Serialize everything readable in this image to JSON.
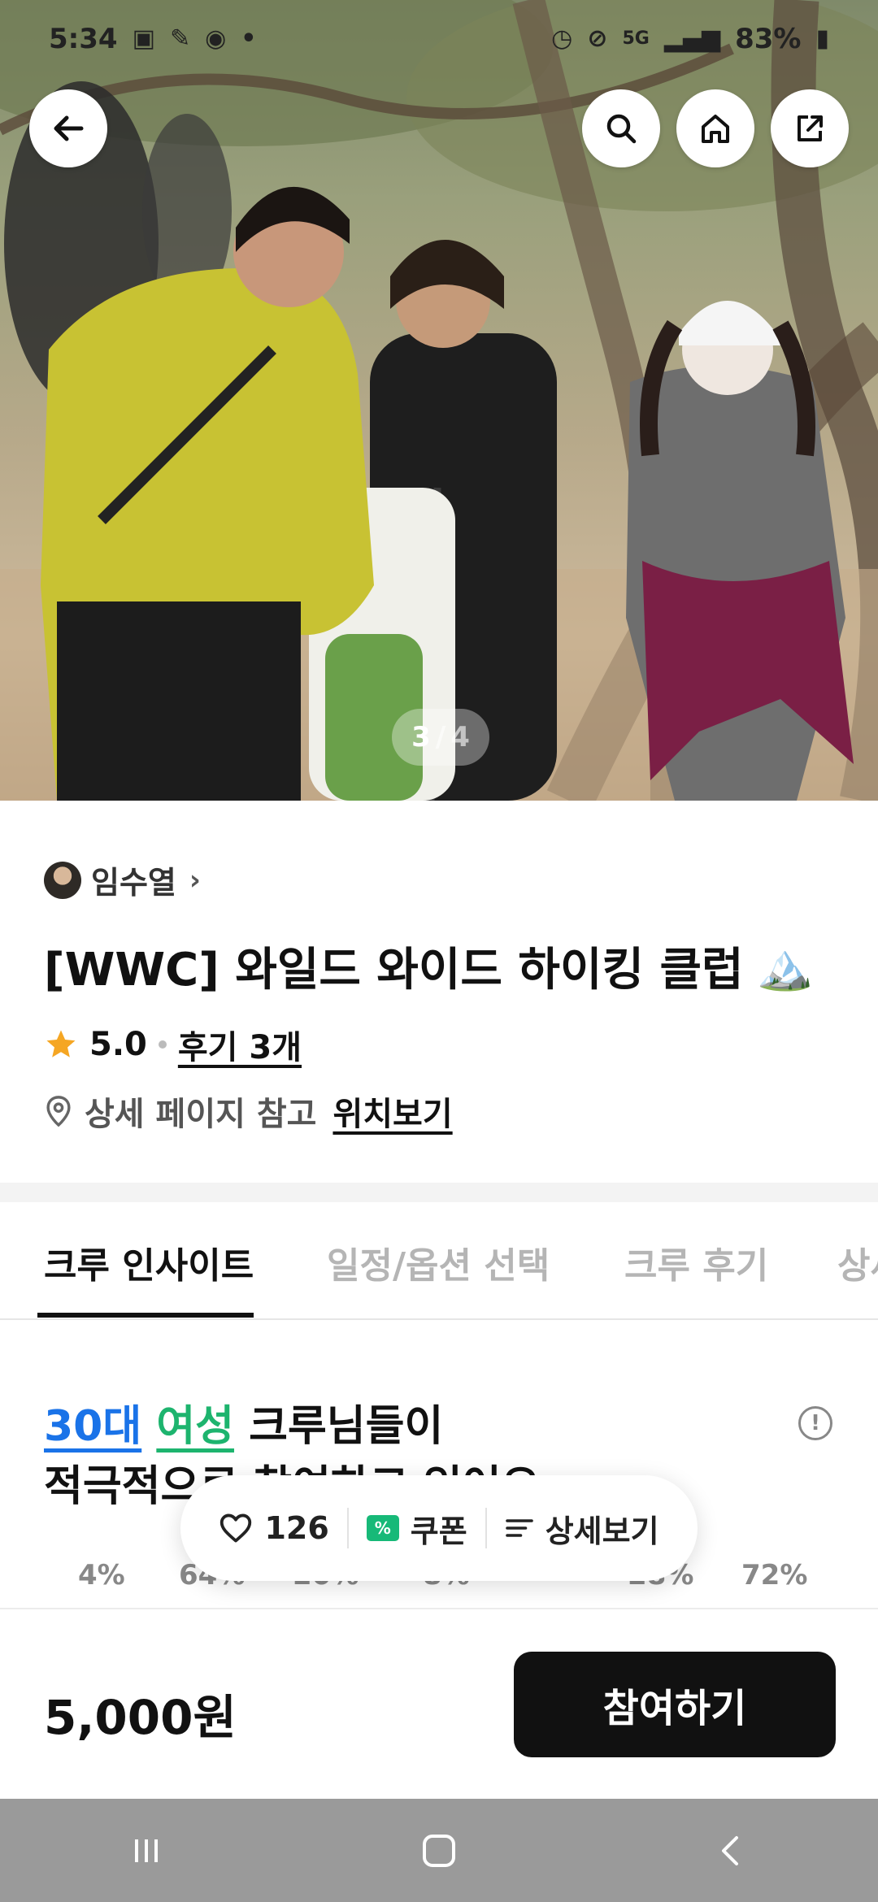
{
  "status_bar": {
    "time": "5:34",
    "battery": "83%",
    "network": "5G"
  },
  "hero": {
    "page_current": "3",
    "page_separator": "/",
    "page_total": "4"
  },
  "host": {
    "name": "임수열",
    "chevron": "›"
  },
  "crew": {
    "title": "[WWC] 와일드 와이드 하이킹 클럽",
    "title_emoji": "🏔️",
    "rating": "5.0",
    "reviews_label": "후기 3개",
    "location_text": "상세 페이지 참고",
    "location_link": "위치보기"
  },
  "tabs": [
    {
      "label": "크루 인사이트"
    },
    {
      "label": "일정/옵션 선택"
    },
    {
      "label": "크루 후기"
    },
    {
      "label": "상세"
    }
  ],
  "insight": {
    "age": "30대",
    "gender": "여성",
    "line1_rest": "크루님들이",
    "line2": "적극적으로 참여하고 있어요",
    "percentages": [
      "4%",
      "64%",
      "20%",
      "8%",
      "28%",
      "72%"
    ]
  },
  "floating_bar": {
    "likes": "126",
    "coupon_label": "쿠폰",
    "coupon_icon_text": "%",
    "detail_label": "상세보기"
  },
  "bottom": {
    "price": "5,000원",
    "cta_label": "참여하기"
  },
  "colors": {
    "accent_blue": "#1a73e8",
    "accent_green": "#1db46e",
    "star": "#f5a623",
    "cta": "#111111"
  }
}
